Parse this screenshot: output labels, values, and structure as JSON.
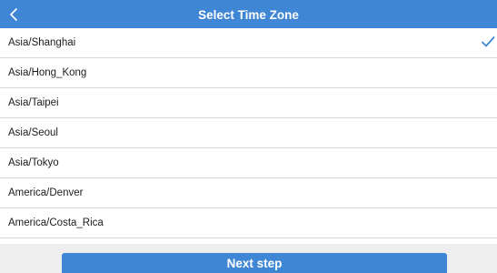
{
  "header": {
    "back_icon": "chevron-left-icon",
    "title": "Select Time Zone"
  },
  "timezones": [
    {
      "label": "Asia/Shanghai",
      "selected": true
    },
    {
      "label": "Asia/Hong_Kong",
      "selected": false
    },
    {
      "label": "Asia/Taipei",
      "selected": false
    },
    {
      "label": "Asia/Seoul",
      "selected": false
    },
    {
      "label": "Asia/Tokyo",
      "selected": false
    },
    {
      "label": "America/Denver",
      "selected": false
    },
    {
      "label": "America/Costa_Rica",
      "selected": false
    }
  ],
  "selected_icon": "checkmark-icon",
  "footer": {
    "next_label": "Next step"
  },
  "colors": {
    "accent": "#3f86d4",
    "divider": "#d9d9d9",
    "footer_bg": "#eeeeee"
  }
}
